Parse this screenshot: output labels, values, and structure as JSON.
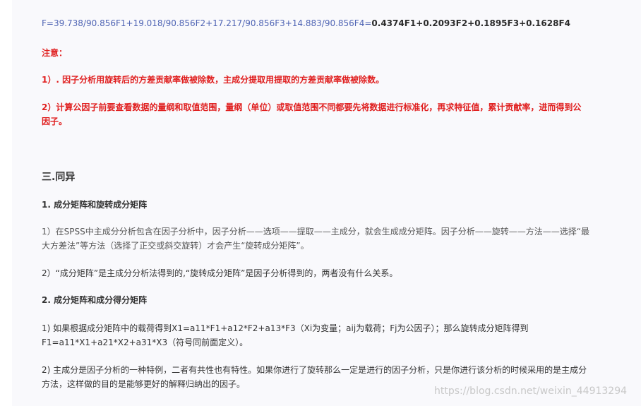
{
  "formula": {
    "lhs": "F=39.738/90.856F1+19.018/90.856F2+17.217/90.856F3+14.883/90.856F4=",
    "rhs": "0.4374F1+0.2093F2+0.1895F3+0.1628F4"
  },
  "notes": {
    "title": "注意：",
    "n1": "1）. 因子分析用旋转后的方差贡献率做被除数，主成分提取用提取的方差贡献率做被除数。",
    "n2_line1": "2）计算公因子前要查看数据的量纲和取值范围，量纲（单位）或取值范围不同都要先将数据进行标准化，再求特征值，累计贡献率，进而得到公",
    "n2_line2": "因子。"
  },
  "section3": {
    "title": "三.同异",
    "h1": "1. 成分矩阵和旋转成分矩阵",
    "p1_line1": "1）在SPSS中主成分分析包含在因子分析中，因子分析——选项——提取——主成分，就会生成成分矩阵。因子分析——旋转——方法——选择“最",
    "p1_line2": "大方差法”等方法（选择了正交或斜交旋转）才会产生“旋转成分矩阵”。",
    "p2": "2）“成分矩阵”是主成分分析法得到的,“旋转成分矩阵”是因子分析得到的，两者没有什么关系。",
    "h2": "2. 成分矩阵和成分得分矩阵",
    "p3_line1": "1) 如果根据成分矩阵中的载荷得到X1=a11*F1+a12*F2+a13*F3（Xi为变量；aij为载荷；Fj为公因子）；那么旋转成分矩阵得到",
    "p3_line2": "F1=a11*X1+a21*X2+a31*X3（符号同前面定义）。",
    "p4_line1": "2) 主成分是因子分析的一种特例，二者有共性也有特性。如果你进行了旋转那么一定是进行的因子分析，只是你进行该分析的时候采用的是主成分",
    "p4_line2": "方法，这样做的目的是能够更好的解释归纳出的因子。"
  },
  "watermark": "https://blog.csdn.net/weixin_44913294"
}
